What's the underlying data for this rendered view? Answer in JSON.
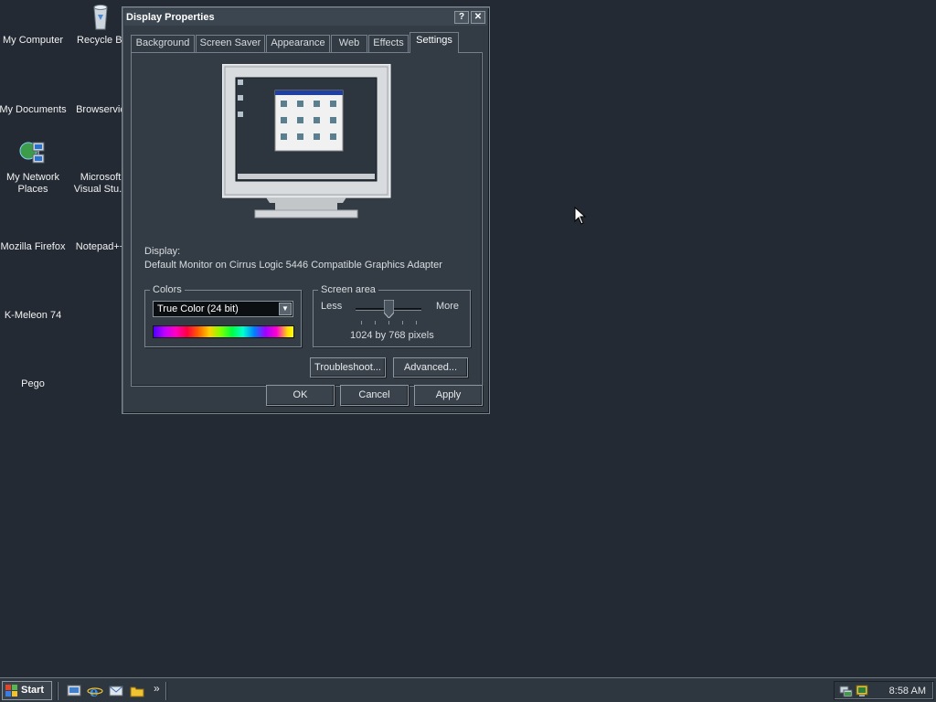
{
  "desktop": {
    "icons": [
      {
        "label": "My Computer",
        "icon": "my-computer-icon"
      },
      {
        "label": "Recycle Bi",
        "icon": "recycle-bin-icon"
      },
      {
        "label": "My Documents",
        "icon": "my-documents-icon"
      },
      {
        "label": "Browservic",
        "icon": "browserservice-icon"
      },
      {
        "label": "My Network Places",
        "icon": "network-places-icon"
      },
      {
        "label": "Microsoft Visual Stu...",
        "icon": "visual-studio-icon"
      },
      {
        "label": "Mozilla Firefox",
        "icon": "firefox-icon"
      },
      {
        "label": "Notepad++",
        "icon": "notepad-plus-icon"
      },
      {
        "label": "K-Meleon 74",
        "icon": "kmeleon-icon"
      },
      {
        "label": "Pego",
        "icon": "pego-icon"
      }
    ]
  },
  "dialog": {
    "title": "Display Properties",
    "help_button": "?",
    "close_button": "✕",
    "tabs": [
      {
        "label": "Background",
        "active": false
      },
      {
        "label": "Screen Saver",
        "active": false
      },
      {
        "label": "Appearance",
        "active": false
      },
      {
        "label": "Web",
        "active": false
      },
      {
        "label": "Effects",
        "active": false
      },
      {
        "label": "Settings",
        "active": true
      }
    ],
    "settings": {
      "display_label": "Display:",
      "display_value": "Default Monitor on Cirrus Logic 5446 Compatible Graphics Adapter",
      "colors_group": "Colors",
      "colors_selected": "True Color (24 bit)",
      "screen_area_group": "Screen area",
      "less_label": "Less",
      "more_label": "More",
      "resolution_text": "1024 by 768 pixels",
      "slider_level_fraction": 0.5,
      "troubleshoot_button": "Troubleshoot...",
      "advanced_button": "Advanced..."
    },
    "buttons": {
      "ok": "OK",
      "cancel": "Cancel",
      "apply": "Apply"
    }
  },
  "taskbar": {
    "start_label": "Start",
    "quick_launch": [
      "show-desktop-icon",
      "internet-explorer-icon",
      "outlook-icon",
      "explorer-icon"
    ],
    "more_chevron": "»",
    "clock": "8:58 AM",
    "tray_icons": [
      "network-tray-icon",
      "monitor-tray-icon"
    ]
  }
}
